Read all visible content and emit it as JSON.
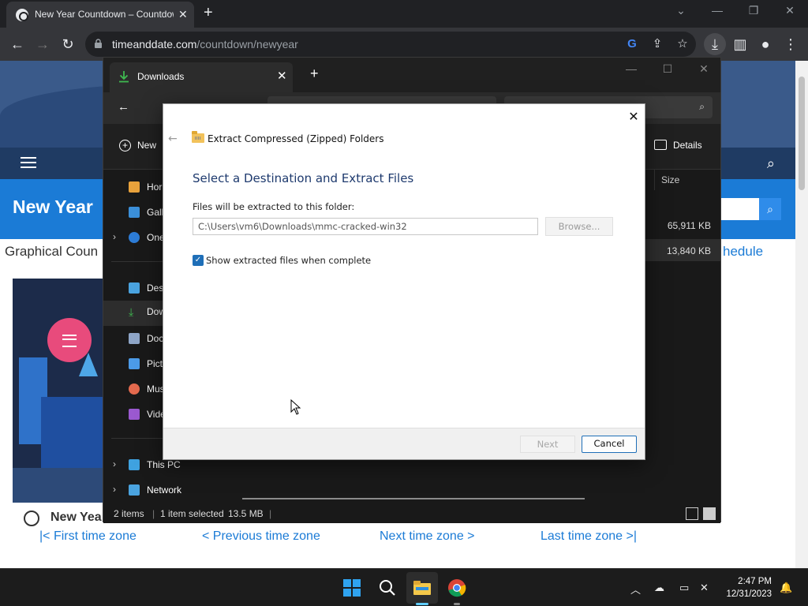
{
  "browser": {
    "tab_title": "New Year Countdown – Countdown",
    "url_host": "timeanddate.com",
    "url_path": "/countdown/newyear"
  },
  "webpage": {
    "page_title": "New Year",
    "subtitle": "Graphical Coun",
    "schedule_link": "hedule",
    "footer_title": "New Yea",
    "first_tz": "|< First time zone",
    "prev_tz": "< Previous time zone",
    "next_tz": "Next time zone >",
    "last_tz": "Last time zone >|"
  },
  "explorer": {
    "tab_label": "Downloads",
    "new_label": "New",
    "details_label": "Details",
    "nav_items": [
      {
        "label": "Hor",
        "color": "#e8a23c"
      },
      {
        "label": "Gall",
        "color": "#3b8fd9"
      },
      {
        "label": "One",
        "color": "#2d7cd6"
      },
      {
        "label": "Desi",
        "color": "#4aa3df"
      },
      {
        "label": "Dow",
        "color": "#3fb950"
      },
      {
        "label": "Doc",
        "color": "#8ea5c7"
      },
      {
        "label": "Pict",
        "color": "#4c9be8"
      },
      {
        "label": "Mus",
        "color": "#e46a4e"
      },
      {
        "label": "Vide",
        "color": "#9b59d0"
      },
      {
        "label": "This PC",
        "color": "#3fa2e0"
      },
      {
        "label": "Network",
        "color": "#4aa3df"
      }
    ],
    "column_size": "Size",
    "file_sizes": [
      "65,911 KB",
      "13,840 KB"
    ],
    "status_items": "2 items",
    "status_selected": "1 item selected",
    "status_size": "13.5 MB"
  },
  "dialog": {
    "wizard_title": "Extract Compressed (Zipped) Folders",
    "heading": "Select a Destination and Extract Files",
    "files_label": "Files will be extracted to this folder:",
    "path_value": "C:\\Users\\vm6\\Downloads\\mmc-cracked-win32",
    "browse_label": "Browse...",
    "checkbox_label": "Show extracted files when complete",
    "checkbox_checked": true,
    "next_label": "Next",
    "cancel_label": "Cancel"
  },
  "taskbar": {
    "time": "2:47 PM",
    "date": "12/31/2023"
  },
  "colors": {
    "accent": "#1f6fb8",
    "heading_blue": "#1e3a6e",
    "page_blue": "#1b7bd6"
  }
}
